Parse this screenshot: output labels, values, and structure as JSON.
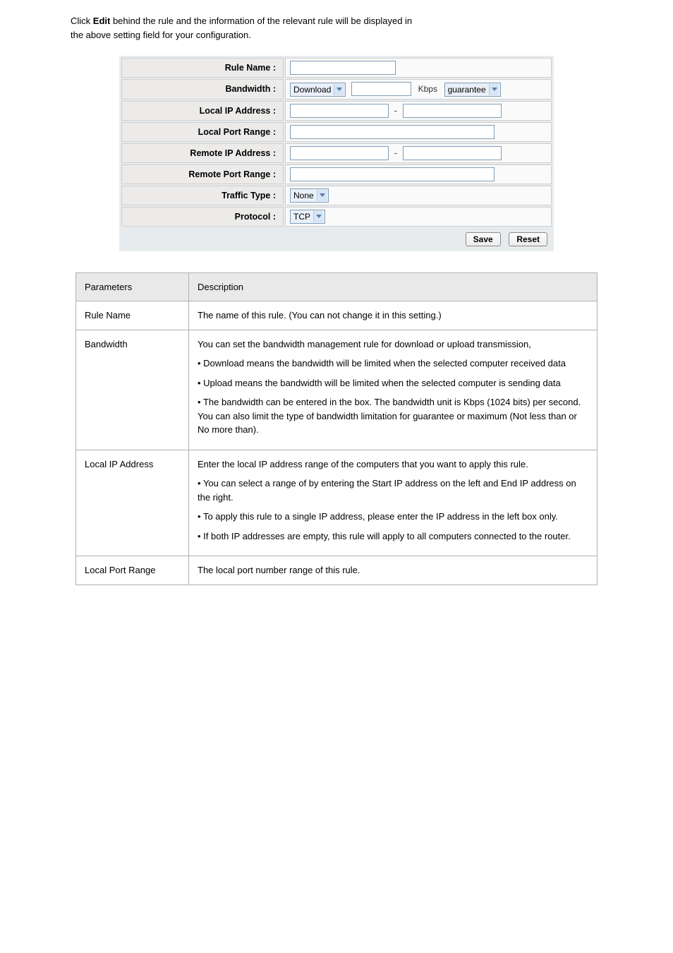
{
  "intro": {
    "line1_prefix": "Click ",
    "line1_bold": "Edit",
    "line1_suffix": " behind the rule and the information of the relevant rule will be displayed in",
    "line2": "the above setting field for your configuration."
  },
  "form": {
    "labels": {
      "rule_name": "Rule Name :",
      "bandwidth": "Bandwidth :",
      "local_ip": "Local IP Address :",
      "local_port": "Local Port Range :",
      "remote_ip": "Remote IP Address :",
      "remote_port": "Remote Port Range :",
      "traffic_type": "Traffic Type :",
      "protocol": "Protocol :"
    },
    "values": {
      "rule_name": "",
      "bandwidth_direction": "Download",
      "bandwidth_value": "",
      "bandwidth_unit": "Kbps",
      "bandwidth_mode": "guarantee",
      "local_ip_start": "",
      "local_ip_end": "",
      "local_port": "",
      "remote_ip_start": "",
      "remote_ip_end": "",
      "remote_port": "",
      "traffic_type": "None",
      "protocol": "TCP"
    },
    "buttons": {
      "save": "Save",
      "reset": "Reset"
    }
  },
  "table": {
    "headers": {
      "param": "Parameters",
      "desc": "Description"
    },
    "rows": [
      {
        "param": "Rule Name",
        "desc": "The name of this rule. (You can not change it in this setting.)"
      },
      {
        "param": "Bandwidth",
        "desc_prefix": "You can set the bandwidth management rule for download or upload transmission,",
        "bullets": [
          "Download means the bandwidth will be limited when the selected computer received data",
          "Upload means the bandwidth will be limited when the selected computer is sending data",
          "The bandwidth can be entered in the box. The bandwidth unit is Kbps (1024 bits) per second. You can also limit the type of bandwidth limitation for guarantee or maximum (Not less than or No more than)."
        ]
      },
      {
        "param": "Local IP Address",
        "desc_prefix": "Enter the local IP address range of the computers that you want to apply this rule.",
        "bullets": [
          "You can select a range of by entering the Start IP address on the left and End IP address on the right.",
          "To apply this rule to a single IP address, please enter the IP address in the left box only.",
          "If both IP addresses are empty, this rule will apply to all computers connected to the router."
        ]
      },
      {
        "param": "Local Port Range",
        "desc": "The local port number range of this rule."
      }
    ]
  }
}
